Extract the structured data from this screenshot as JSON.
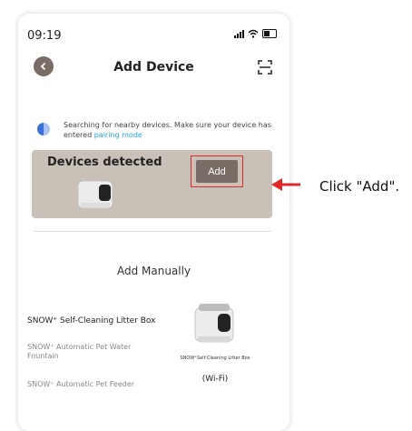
{
  "status": {
    "time": "09:19"
  },
  "header": {
    "title": "Add Device"
  },
  "search": {
    "text": "Searching for nearby devices. Make sure your device has entered",
    "link": "pairing mode"
  },
  "detected": {
    "title": "Devices detected",
    "add_label": "Add"
  },
  "manual": {
    "title": "Add Manually",
    "items": [
      {
        "label": "SNOW⁺ Self-Cleaning Litter Box"
      },
      {
        "label": "SNOW⁺ Automatic Pet Water Fountain"
      },
      {
        "label": "SNOW⁺ Automatic Pet Feeder"
      }
    ],
    "product_caption": "SNOW⁺Self-Cleaning Litter Box",
    "product_connection": "(Wi-Fi)"
  },
  "annotation": {
    "text": "Click \"Add\"."
  },
  "colors": {
    "accent": "#7a6d66",
    "card": "#c9c0b8",
    "highlight": "#e02a2a",
    "link": "#2aa0e0"
  },
  "icons": [
    "back-arrow-icon",
    "scan-icon",
    "signal-icon",
    "wifi-icon",
    "battery-icon",
    "search-status-icon"
  ]
}
